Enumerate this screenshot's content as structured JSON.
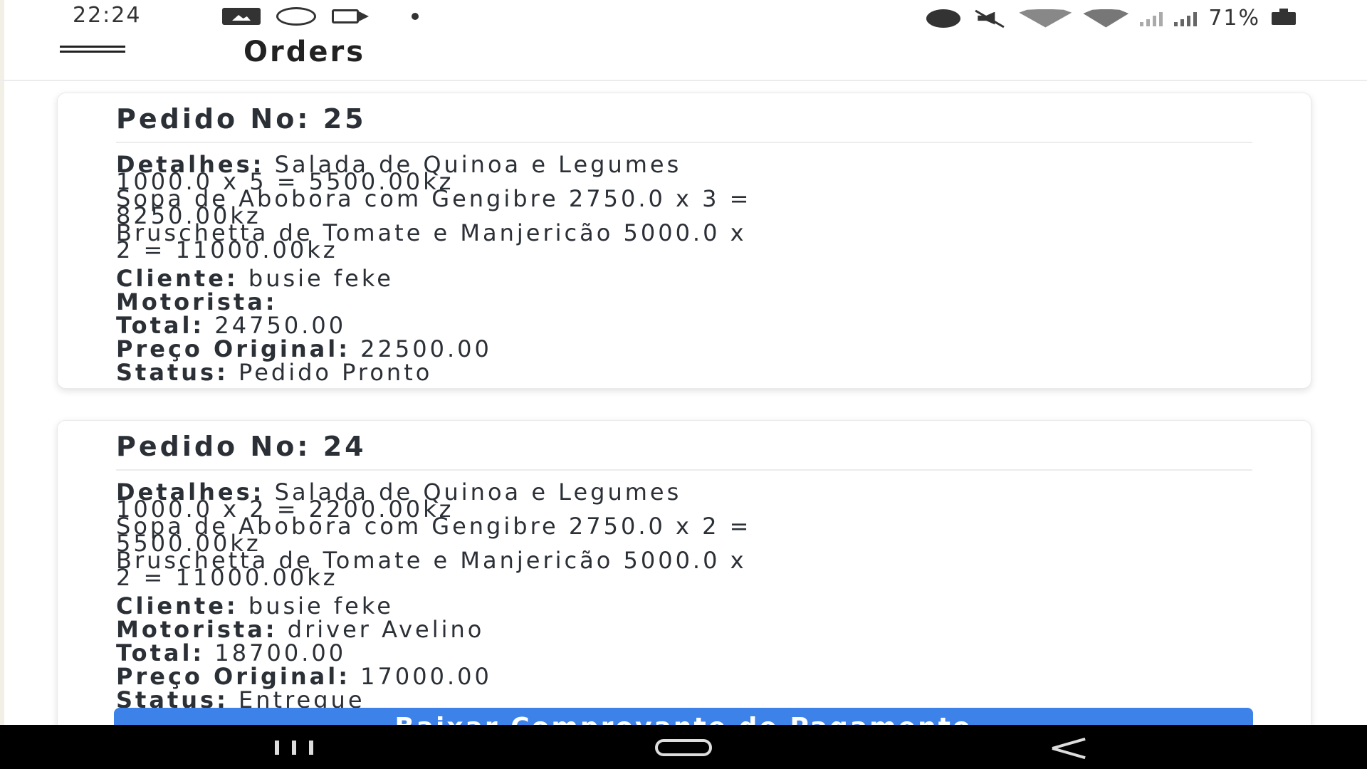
{
  "status_bar": {
    "time": "22:24",
    "battery": "71%",
    "left_icons": [
      "gallery-icon",
      "whatsapp-icon",
      "video-icon",
      "notification-dot-icon"
    ],
    "right_icons": [
      "alarm-icon",
      "mute-icon",
      "wifi-icon",
      "wifi-call-icon",
      "signal-icon",
      "signal-icon",
      "battery-icon"
    ]
  },
  "app_bar": {
    "menu_icon": "hamburger-menu-icon",
    "title": "Orders"
  },
  "orders": [
    {
      "title": "Pedido No: 25",
      "details_label": "Detalhes:",
      "details_lines": [
        " Salada de Quinoa e Legumes",
        "1000.0 x 5 = 5500.00kz",
        "Sopa de Abobora com Gengibre 2750.0 x 3 =",
        "8250.00kz",
        "Bruschetta de Tomate e Manjericão 5000.0 x",
        "2 = 11000.00kz"
      ],
      "cliente_label": "Cliente:",
      "cliente": " busie feke",
      "motorista_label": "Motorista:",
      "motorista": "",
      "total_label": "Total:",
      "total": " 24750.00",
      "preco_label": "Preço Original:",
      "preco": " 22500.00",
      "status_label": "Status:",
      "status": " Pedido Pronto"
    },
    {
      "title": "Pedido No: 24",
      "details_label": "Detalhes:",
      "details_lines": [
        " Salada de Quinoa e Legumes",
        "1000.0 x 2 = 2200.00kz",
        "Sopa de Abobora com Gengibre 2750.0 x 2 =",
        "5500.00kz",
        "Bruschetta de Tomate e Manjericão 5000.0 x",
        "2 = 11000.00kz"
      ],
      "cliente_label": "Cliente:",
      "cliente": " busie feke",
      "motorista_label": "Motorista:",
      "motorista": " driver Avelino",
      "total_label": "Total:",
      "total": " 18700.00",
      "preco_label": "Preço Original:",
      "preco": " 17000.00",
      "status_label": "Status:",
      "status": " Entregue",
      "button_label": "Baixar Comprovante de Pagamento"
    }
  ],
  "nav_bar": {
    "icons": [
      "recent-apps-icon",
      "home-icon",
      "back-icon"
    ]
  },
  "colors": {
    "accent_button": "#3c82e8",
    "text": "#2b2f36",
    "nav_background": "#000000"
  }
}
